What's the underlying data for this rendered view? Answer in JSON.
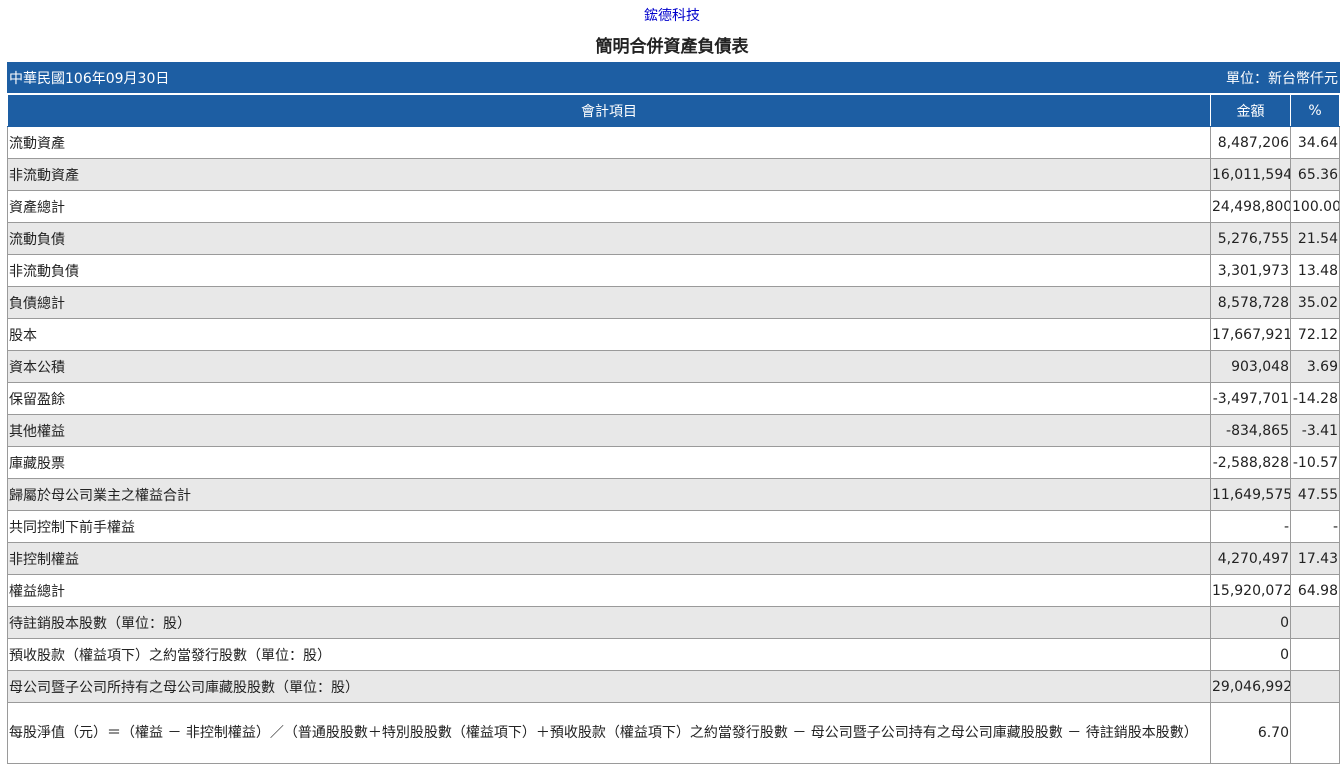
{
  "company": "鋐德科技",
  "title": "簡明合併資產負債表",
  "date": "中華民國106年09月30日",
  "unit": "單位：新台幣仟元",
  "headers": {
    "item": "會計項目",
    "amount": "金額",
    "percent": "%"
  },
  "rows": [
    {
      "item": "流動資產",
      "amount": "8,487,206",
      "percent": "34.64"
    },
    {
      "item": "非流動資產",
      "amount": "16,011,594",
      "percent": "65.36"
    },
    {
      "item": "資產總計",
      "amount": "24,498,800",
      "percent": "100.00"
    },
    {
      "item": "流動負債",
      "amount": "5,276,755",
      "percent": "21.54"
    },
    {
      "item": "非流動負債",
      "amount": "3,301,973",
      "percent": "13.48"
    },
    {
      "item": "負債總計",
      "amount": "8,578,728",
      "percent": "35.02"
    },
    {
      "item": "股本",
      "amount": "17,667,921",
      "percent": "72.12"
    },
    {
      "item": "資本公積",
      "amount": "903,048",
      "percent": "3.69"
    },
    {
      "item": "保留盈餘",
      "amount": "-3,497,701",
      "percent": "-14.28"
    },
    {
      "item": "其他權益",
      "amount": "-834,865",
      "percent": "-3.41"
    },
    {
      "item": "庫藏股票",
      "amount": "-2,588,828",
      "percent": "-10.57"
    },
    {
      "item": "歸屬於母公司業主之權益合計",
      "amount": "11,649,575",
      "percent": "47.55"
    },
    {
      "item": "共同控制下前手權益",
      "amount": "-",
      "percent": "-"
    },
    {
      "item": "非控制權益",
      "amount": "4,270,497",
      "percent": "17.43"
    },
    {
      "item": "權益總計",
      "amount": "15,920,072",
      "percent": "64.98"
    },
    {
      "item": "待註銷股本股數（單位：股）",
      "amount": "0",
      "percent": ""
    },
    {
      "item": "預收股款（權益項下）之約當發行股數（單位：股）",
      "amount": "0",
      "percent": ""
    },
    {
      "item": "母公司暨子公司所持有之母公司庫藏股股數（單位：股）",
      "amount": "29,046,992",
      "percent": ""
    },
    {
      "item": "每股淨值（元）＝（權益 － 非控制權益）／（普通股股數＋特別股股數（權益項下）＋預收股款（權益項下）之約當發行股數 － 母公司暨子公司持有之母公司庫藏股股數 － 待註銷股本股數）",
      "amount": "6.70",
      "percent": ""
    }
  ]
}
